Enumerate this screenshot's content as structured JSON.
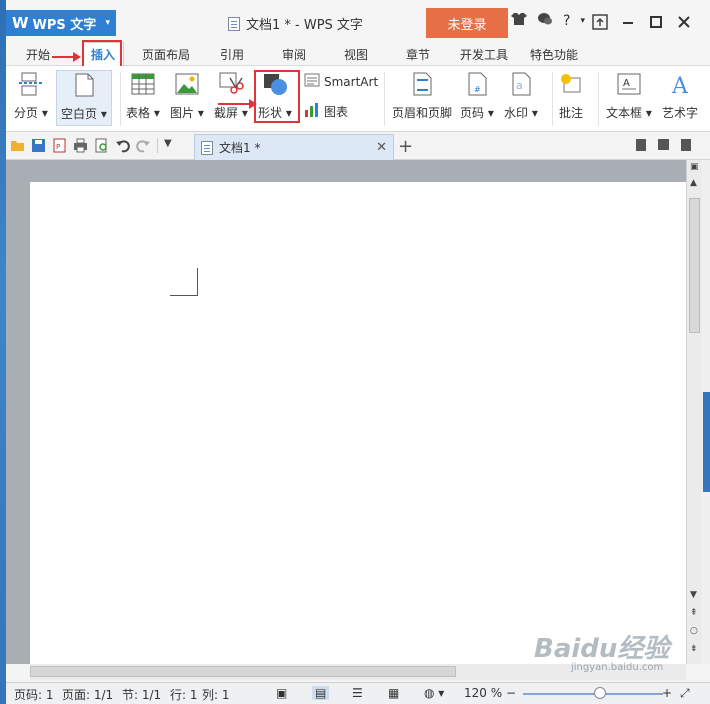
{
  "app": {
    "logo": "W",
    "name": "WPS 文字",
    "dropdown": "▾"
  },
  "window": {
    "title": "文档1 * - WPS 文字",
    "login_label": "未登录",
    "icons": [
      "shirt-icon",
      "chat-icon",
      "help-icon",
      "chevron-down-icon"
    ],
    "help_glyph": "?",
    "controls": [
      "upload-icon",
      "minimize-icon",
      "maximize-icon",
      "close-icon"
    ]
  },
  "tabs": [
    {
      "label": "开始"
    },
    {
      "label": "插入",
      "active": true
    },
    {
      "label": "页面布局"
    },
    {
      "label": "引用"
    },
    {
      "label": "审阅"
    },
    {
      "label": "视图"
    },
    {
      "label": "章节"
    },
    {
      "label": "开发工具"
    },
    {
      "label": "特色功能"
    }
  ],
  "ribbon": {
    "page_break": "分页",
    "blank_page": "空白页",
    "table": "表格",
    "picture": "图片",
    "screenshot": "截屏",
    "shape": "形状",
    "smartart": "SmartArt",
    "chart": "图表",
    "header_footer": "页眉和页脚",
    "page_number": "页码",
    "watermark": "水印",
    "comment": "批注",
    "textbox": "文本框",
    "wordart": "艺术字",
    "dropdown": "▾"
  },
  "doc_tabs": [
    {
      "label": "文档1 *"
    }
  ],
  "status": {
    "page_no": "页码: 1",
    "pages": "页面: 1/1",
    "section": "节: 1/1",
    "row": "行: 1",
    "col": "列: 1",
    "zoom": "120 %",
    "zoom_level_fraction": 0.55
  },
  "watermark": {
    "text": "Baidu经验",
    "url": "jingyan.baidu.com"
  },
  "colors": {
    "accent": "#2f7fd3",
    "login": "#e76f45",
    "highlight": "#e0343a"
  }
}
